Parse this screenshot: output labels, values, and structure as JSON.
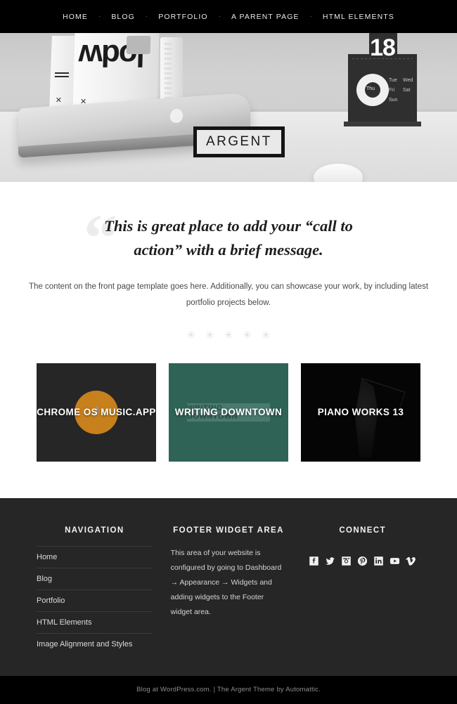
{
  "site": {
    "logo": "ARGENT"
  },
  "topnav": {
    "separator": "·",
    "items": [
      {
        "label": "HOME"
      },
      {
        "label": "BLOG"
      },
      {
        "label": "PORTFOLIO"
      },
      {
        "label": "A PARENT PAGE"
      },
      {
        "label": "HTML ELEMENTS"
      }
    ]
  },
  "hero": {
    "calendar_number": "18",
    "calendar_days": [
      "Tue",
      "Wed",
      "Thu",
      "Fri",
      "Sat",
      "Sun"
    ],
    "book_title": "lodw"
  },
  "cta": {
    "quote_glyph": "“",
    "headline": "This is great place to add your “call to action” with a brief message.",
    "body": "The content on the front page template goes here. Additionally, you can showcase your work, by including latest portfolio projects below.",
    "stars": [
      "✳",
      "✳",
      "✳",
      "✳",
      "✳"
    ]
  },
  "portfolio": {
    "tiles": [
      {
        "title": "CHROME OS MUSIC.APP",
        "color": "#262626",
        "accent": "#c8801c"
      },
      {
        "title": "WRITING DOWNTOWN",
        "color": "#2e6355",
        "art_label": "WRITING DOWNTOWN"
      },
      {
        "title": "PIANO WORKS 13",
        "color": "#050505"
      }
    ]
  },
  "footer": {
    "navigation": {
      "title": "NAVIGATION",
      "items": [
        {
          "label": "Home"
        },
        {
          "label": "Blog"
        },
        {
          "label": "Portfolio"
        },
        {
          "label": "HTML Elements"
        },
        {
          "label": "Image Alignment and Styles"
        }
      ]
    },
    "widget": {
      "title": "FOOTER WIDGET AREA",
      "text": "This area of your website is configured by going to Dashboard → Appearance → Widgets and adding widgets to the Footer widget area."
    },
    "connect": {
      "title": "CONNECT",
      "icons": [
        {
          "name": "facebook-icon"
        },
        {
          "name": "twitter-icon"
        },
        {
          "name": "instagram-icon"
        },
        {
          "name": "pinterest-icon"
        },
        {
          "name": "linkedin-icon"
        },
        {
          "name": "youtube-icon"
        },
        {
          "name": "vimeo-icon"
        }
      ]
    }
  },
  "credit": {
    "text": "Blog at WordPress.com. | The Argent Theme by Automattic."
  }
}
